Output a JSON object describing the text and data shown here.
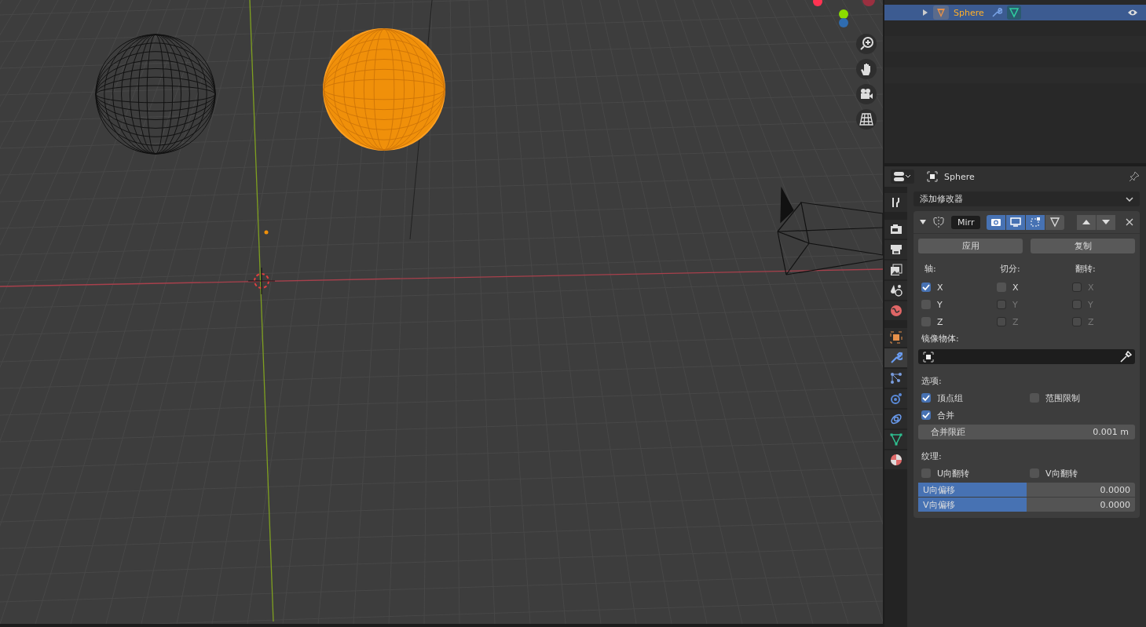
{
  "outliner": {
    "items": [
      {
        "name": "Sphere",
        "selected": true,
        "expanded": false,
        "visible": true
      }
    ]
  },
  "properties": {
    "object_name": "Sphere",
    "tabs": [
      {
        "kind": "tool",
        "selected": false
      },
      {
        "kind": "render",
        "selected": false
      },
      {
        "kind": "output",
        "selected": false
      },
      {
        "kind": "view-layer",
        "selected": false
      },
      {
        "kind": "scene",
        "selected": false
      },
      {
        "kind": "world",
        "selected": false
      },
      {
        "kind": "object",
        "selected": false
      },
      {
        "kind": "modifiers",
        "selected": true
      },
      {
        "kind": "particles",
        "selected": false
      },
      {
        "kind": "physics",
        "selected": false
      },
      {
        "kind": "constraints",
        "selected": false
      },
      {
        "kind": "data",
        "selected": false
      },
      {
        "kind": "material",
        "selected": false
      }
    ],
    "add_modifier": "添加修改器",
    "modifier": {
      "name": "Mirr",
      "expanded": true,
      "toggles": [
        {
          "kind": "render",
          "on": true
        },
        {
          "kind": "viewport",
          "on": true
        },
        {
          "kind": "editmode",
          "on": true
        },
        {
          "kind": "cage",
          "on": false
        }
      ],
      "buttons": [
        "应用",
        "复制"
      ],
      "axis_columns": [
        {
          "label": "轴:",
          "items": [
            {
              "label": "X",
              "checked": true,
              "disabled": false
            },
            {
              "label": "Y",
              "checked": false,
              "disabled": false
            },
            {
              "label": "Z",
              "checked": false,
              "disabled": false
            }
          ]
        },
        {
          "label": "切分:",
          "items": [
            {
              "label": "X",
              "checked": false,
              "disabled": false
            },
            {
              "label": "Y",
              "checked": false,
              "disabled": true
            },
            {
              "label": "Z",
              "checked": false,
              "disabled": true
            }
          ]
        },
        {
          "label": "翻转:",
          "items": [
            {
              "label": "X",
              "checked": false,
              "disabled": true
            },
            {
              "label": "Y",
              "checked": false,
              "disabled": true
            },
            {
              "label": "Z",
              "checked": false,
              "disabled": true
            }
          ]
        }
      ],
      "mirror_object_label": "镜像物体:",
      "options_label": "选项:",
      "options": [
        {
          "label": "顶点组",
          "checked": true
        },
        {
          "label": "范围限制",
          "checked": false
        },
        {
          "label": "合并",
          "checked": true
        }
      ],
      "merge_limit": {
        "label": "合并限距",
        "value": "0.001 m"
      },
      "textures_label": "纹理:",
      "texture_flips": [
        {
          "label": "U向翻转",
          "checked": false
        },
        {
          "label": "V向翻转",
          "checked": false
        }
      ],
      "offsets": [
        {
          "label": "U向偏移",
          "value": "0.0000",
          "level": 0.5
        },
        {
          "label": "V向偏移",
          "value": "0.0000",
          "level": 0.5
        }
      ]
    }
  }
}
